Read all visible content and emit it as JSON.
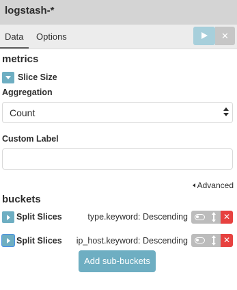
{
  "header": {
    "title": "logstash-*"
  },
  "tabs": [
    {
      "label": "Data",
      "active": true
    },
    {
      "label": "Options",
      "active": false
    }
  ],
  "toolbar": {
    "apply_icon": "play-icon",
    "discard_label": "✕"
  },
  "metrics": {
    "title": "metrics",
    "item": {
      "label": "Slice Size",
      "aggregation_label": "Aggregation",
      "aggregation_value": "Count",
      "custom_label_label": "Custom Label",
      "custom_label_value": ""
    },
    "advanced_label": "Advanced"
  },
  "buckets": {
    "title": "buckets",
    "items": [
      {
        "label": "Split Slices",
        "description": "type.keyword: Descending",
        "remove_label": "✕"
      },
      {
        "label": "Split Slices",
        "description": "ip_host.keyword: Descending",
        "remove_label": "✕"
      }
    ],
    "add_button": "Add sub-buckets"
  },
  "colors": {
    "header_bg": "#d4d4d4",
    "tabbar_bg": "#ececec",
    "accent": "#6eaec2",
    "apply_disabled": "#a7cfdb",
    "danger": "#e7413f",
    "control_grey": "#bcbcbc"
  }
}
